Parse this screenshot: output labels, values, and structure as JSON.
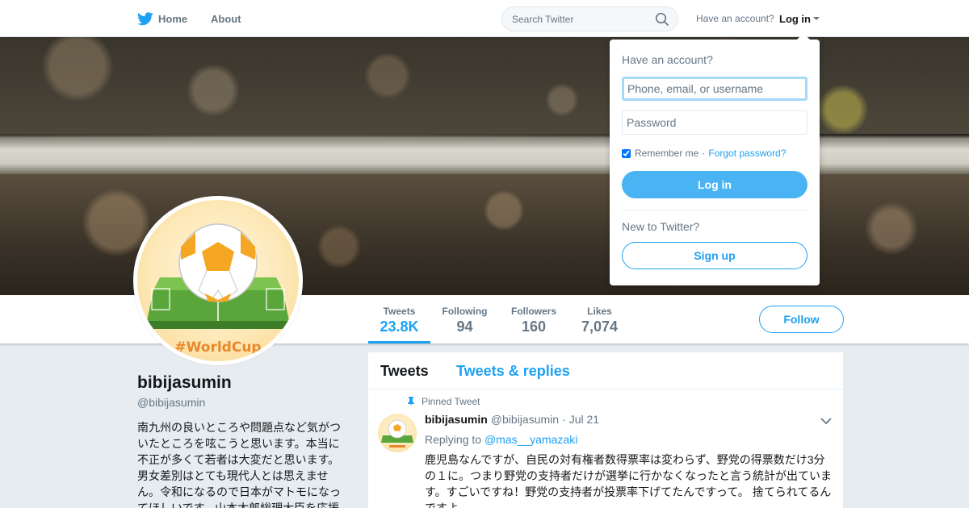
{
  "nav": {
    "home_label": "Home",
    "about_label": "About",
    "search_placeholder": "Search Twitter",
    "have_account": "Have an account?",
    "login_label": "Log in"
  },
  "profile": {
    "name": "bibijasumin",
    "handle": "@bibijasumin",
    "bio": "南九州の良いところや問題点など気がついたところを呟こうと思います。本当に不正が多くて若者は大変だと思います。男女差別はとても現代人とは思えません。令和になるので日本がマトモになってほしいです。山本太郎総理大臣を応援",
    "avatar_text": "#WorldCup"
  },
  "stats": [
    {
      "label": "Tweets",
      "value": "23.8K"
    },
    {
      "label": "Following",
      "value": "94"
    },
    {
      "label": "Followers",
      "value": "160"
    },
    {
      "label": "Likes",
      "value": "7,074"
    }
  ],
  "follow_label": "Follow",
  "timeline": {
    "tabs": [
      "Tweets",
      "Tweets & replies"
    ],
    "pinned_label": "Pinned Tweet",
    "tweet": {
      "fullname": "bibijasumin",
      "username": "@bibijasumin",
      "separator": "·",
      "date": "Jul 21",
      "replying_prefix": "Replying to",
      "replying_to": "@mas__yamazaki",
      "text": "鹿児島なんですが、自民の対有権者数得票率は変わらず、野党の得票数だけ3分の１に。つまり野党の支持者だけが選挙に行かなくなったと言う統計が出ています。すごいですね！野党の支持者が投票率下げてたんですって。 捨てられてるんですよ"
    }
  },
  "login_dropdown": {
    "title": "Have an account?",
    "username_placeholder": "Phone, email, or username",
    "password_placeholder": "Password",
    "remember_label": "Remember me",
    "separator": "·",
    "forgot_label": "Forgot password?",
    "login_button": "Log in",
    "new_label": "New to Twitter?",
    "signup_button": "Sign up"
  },
  "colors": {
    "accent": "#1da1f2",
    "login_button": "#4ab3f4",
    "background": "#e6ecf0"
  },
  "icons": [
    "twitter-bird-icon",
    "search-icon",
    "caret-down-icon",
    "pin-icon",
    "chevron-down-icon"
  ]
}
